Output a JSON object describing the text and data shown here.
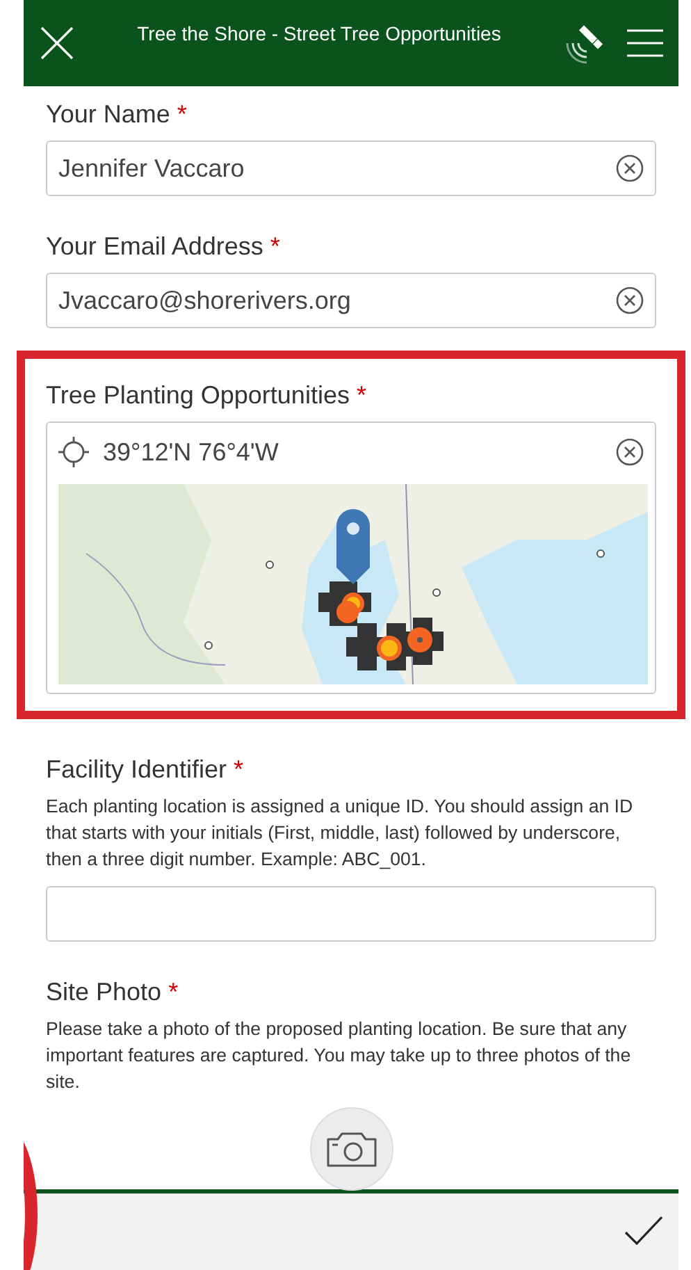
{
  "header": {
    "title": "Tree the Shore - Street Tree Opportunities"
  },
  "questions": [
    {
      "kind": "text",
      "label": "Your Name",
      "required_mark": "*",
      "value": "Jennifer Vaccaro",
      "highlighted": false
    },
    {
      "kind": "text",
      "label": "Your Email Address",
      "required_mark": "*",
      "value": "Jvaccaro@shorerivers.org",
      "highlighted": false
    },
    {
      "kind": "location",
      "label": "Tree Planting Opportunities",
      "required_mark": "*",
      "value": "39°12'N 76°4'W",
      "highlighted": true
    },
    {
      "kind": "text",
      "label": "Facility Identifier",
      "required_mark": "*",
      "hint": "Each planting location is assigned a unique ID. You should assign an ID that starts with your initials (First, middle, last) followed by underscore, then a three digit number. Example: ABC_001.",
      "highlighted": false
    },
    {
      "kind": "photo",
      "label": "Site Photo",
      "required_mark": "*",
      "hint": "Please take a photo of the proposed planting location. Be sure that any important features are captured. You may take up to three photos of the site.",
      "highlighted": false
    }
  ],
  "markup_circle": true
}
